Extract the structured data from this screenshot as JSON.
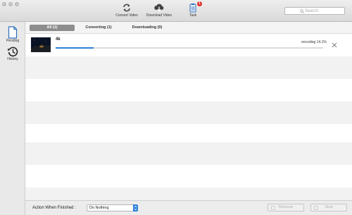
{
  "window": {
    "traffic_lights": [
      "close",
      "minimize",
      "zoom"
    ]
  },
  "toolbar": {
    "items": [
      {
        "label": "Convert Video",
        "icon": "convert-video-icon"
      },
      {
        "label": "Download Video",
        "icon": "download-video-icon"
      },
      {
        "label": "Task",
        "icon": "task-icon",
        "badge": "1"
      }
    ],
    "search_placeholder": "Search"
  },
  "sidebar": {
    "items": [
      {
        "label": "Pending",
        "icon": "pending-icon"
      },
      {
        "label": "History",
        "icon": "history-icon"
      }
    ]
  },
  "tabs": [
    {
      "label": "All (1)",
      "active": true
    },
    {
      "label": "Converting (1)",
      "active": false
    },
    {
      "label": "Downloading (0)",
      "active": false
    }
  ],
  "tasks": [
    {
      "name": "4k",
      "status": "encoding 14.1%",
      "progress": 0.141
    }
  ],
  "footer": {
    "action_label": "Action When Finished :",
    "action_value": "Do Nothing",
    "remove_label": "Remove",
    "stop_label": "Stop"
  },
  "colors": {
    "accent": "#2e83d6",
    "badge": "#e0302a",
    "active_tab": "#8d8d8d"
  }
}
